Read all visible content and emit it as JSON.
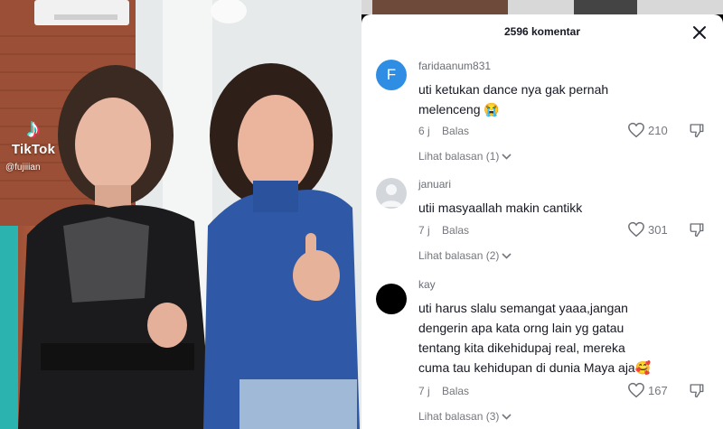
{
  "video": {
    "brand": "TikTok",
    "handle": "@fujiiian"
  },
  "comments_panel": {
    "title": "2596 komentar",
    "close_icon": "close-icon",
    "comments": [
      {
        "avatar_letter": "F",
        "username": "faridaanum831",
        "text_lines": [
          "uti ketukan dance nya gak pernah",
          "melenceng 😭"
        ],
        "time": "6 j",
        "reply_label": "Balas",
        "likes": "210",
        "view_replies": "Lihat balasan (1)"
      },
      {
        "avatar_letter": "",
        "username": "januari",
        "text_lines": [
          "utii masyaallah makin cantikk"
        ],
        "time": "7 j",
        "reply_label": "Balas",
        "likes": "301",
        "view_replies": "Lihat balasan (2)"
      },
      {
        "avatar_letter": "",
        "username": "kay",
        "text_lines": [
          "uti harus slalu semangat yaaa,jangan",
          "dengerin apa kata orng lain yg gatau",
          "tentang kita dikehidupaj real, mereka",
          "cuma tau kehidupan di dunia Maya aja🥰"
        ],
        "time": "7 j",
        "reply_label": "Balas",
        "likes": "167",
        "view_replies": "Lihat balasan (3)"
      }
    ]
  },
  "colors": {
    "text_primary": "#161823",
    "text_secondary": "#75777d",
    "avatar_blue": "#2f8de4"
  }
}
